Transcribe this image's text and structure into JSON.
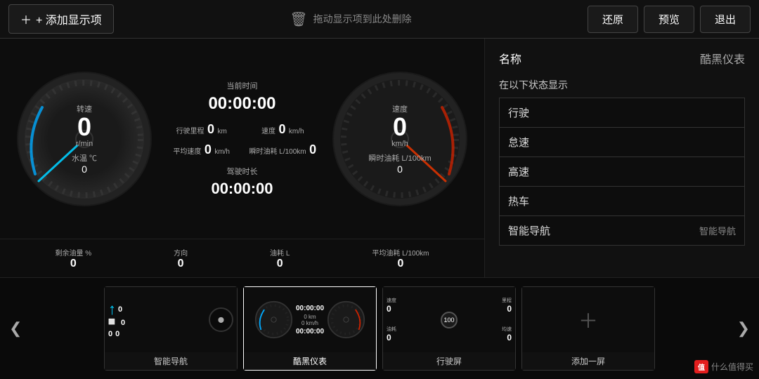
{
  "topbar": {
    "add_label": "+ 添加显示项",
    "trash_hint": "拖动显示项到此处删除",
    "restore_label": "还原",
    "preview_label": "预览",
    "exit_label": "退出"
  },
  "dashboard": {
    "current_time_label": "当前时间",
    "current_time_value": "00:00:00",
    "rpm_label": "转速",
    "rpm_value": "0",
    "rpm_unit": "r/min",
    "temp_label": "水温 ℃",
    "temp_value": "0",
    "speed_label": "速度",
    "speed_value": "0",
    "speed_unit": "km/h",
    "instant_fuel_label": "瞬时油耗 L/100km",
    "instant_fuel_value": "0",
    "mileage_label": "行驶里程",
    "mileage_value": "0",
    "mileage_unit": "km",
    "avg_speed_label": "平均速度",
    "avg_speed_value": "0",
    "avg_speed_unit": "km/h",
    "drive_time_label": "驾驶时长",
    "drive_time_value": "00:00:00",
    "fuel_label": "剩余油量 %",
    "fuel_value": "0",
    "direction_label": "方向",
    "direction_value": "0",
    "fuel_cost_label": "油耗 L",
    "fuel_cost_value": "0",
    "avg_fuel_label": "平均油耗 L/100km",
    "avg_fuel_value": "0"
  },
  "right_panel": {
    "name_label": "名称",
    "name_value": "酷黑仪表",
    "status_title": "在以下状态显示",
    "status_items": [
      {
        "label": "行驶",
        "value": ""
      },
      {
        "label": "怠速",
        "value": ""
      },
      {
        "label": "高速",
        "value": ""
      },
      {
        "label": "热车",
        "value": ""
      },
      {
        "label": "智能导航",
        "value": "智能导航"
      }
    ]
  },
  "thumbnails": [
    {
      "label": "智能导航",
      "active": false
    },
    {
      "label": "酷黑仪表",
      "active": true
    },
    {
      "label": "行驶屏",
      "active": false
    },
    {
      "label": "添加一屏",
      "active": false
    }
  ],
  "watermark": {
    "logo": "值",
    "text": "什么值得买"
  }
}
